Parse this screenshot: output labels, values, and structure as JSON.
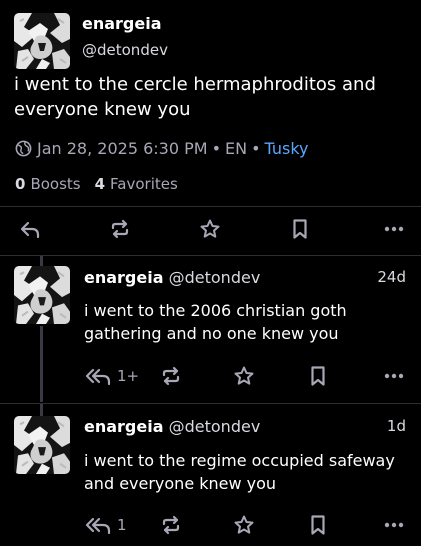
{
  "main_post": {
    "display_name": "enargeia",
    "handle": "@detondev",
    "content": "i went to the cercle hermaphroditos and everyone knew you",
    "timestamp": "Jan 28, 2025 6:30 PM",
    "separator": "•",
    "language": "EN",
    "app": "Tusky",
    "boosts_count": "0",
    "boosts_label": "Boosts",
    "favorites_count": "4",
    "favorites_label": "Favorites",
    "actions": [
      "reply-icon",
      "boost-icon",
      "star-icon",
      "bookmark-icon",
      "more-icon"
    ]
  },
  "replies": [
    {
      "display_name": "enargeia",
      "handle": "@detondev",
      "time": "24d",
      "content": "i went to the 2006 christian goth gathering and no one knew you",
      "reply_count": "1+"
    },
    {
      "display_name": "enargeia",
      "handle": "@detondev",
      "time": "1d",
      "content": "i went to the regime occupied safeway and everyone knew you",
      "reply_count": "1"
    }
  ],
  "colors": {
    "background": "#000000",
    "text": "#ffffff",
    "muted": "#a7a7b6",
    "link": "#5aa6ff",
    "divider": "#2c2c33"
  }
}
